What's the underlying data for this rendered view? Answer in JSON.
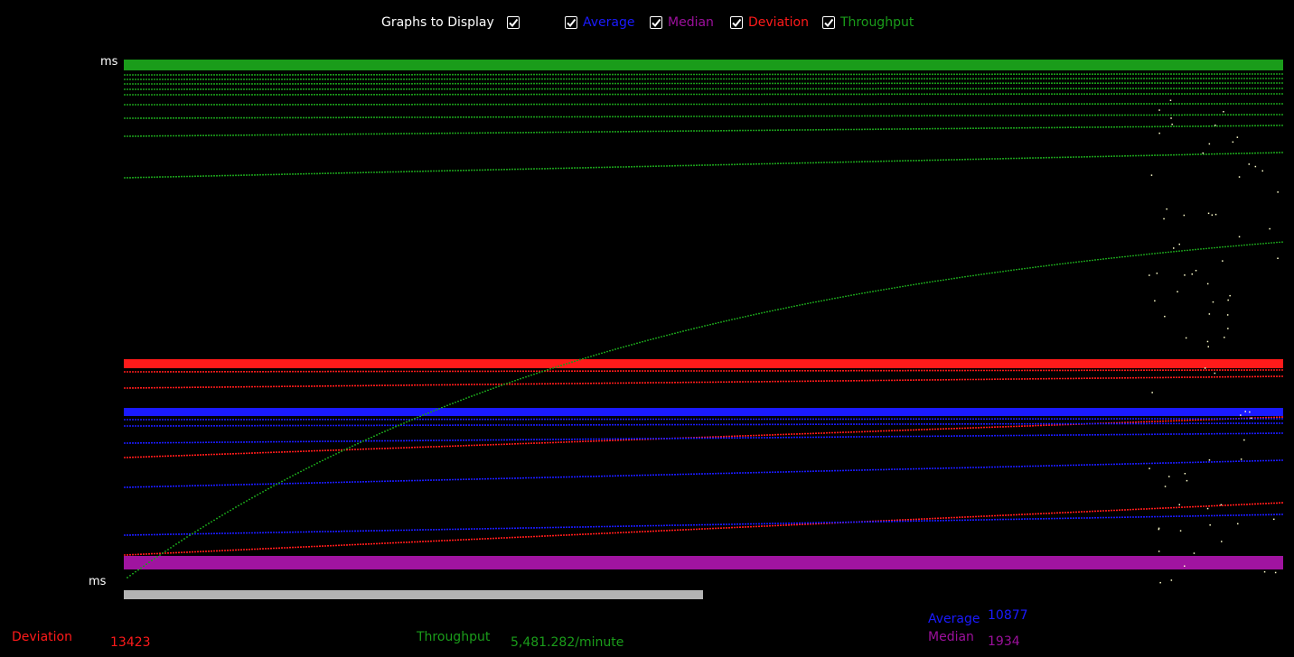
{
  "header": {
    "title": "Graphs to Display",
    "toggles": [
      {
        "label": "Average",
        "checked": true,
        "color": "#1a1aff"
      },
      {
        "label": "Median",
        "checked": true,
        "color": "#9c109c"
      },
      {
        "label": "Deviation",
        "checked": true,
        "color": "#ff1a1a"
      },
      {
        "label": "Throughput",
        "checked": true,
        "color": "#1a9c1a"
      }
    ]
  },
  "axis": {
    "top_unit": "ms",
    "bottom_unit": "ms"
  },
  "progress": {
    "fraction": 0.5
  },
  "stats": {
    "deviation_label": "Deviation",
    "deviation_value": "13423",
    "throughput_label": "Throughput",
    "throughput_value": "5,481.282/minute",
    "average_label": "Average",
    "average_value": "10877",
    "median_label": "Median",
    "median_value": "1934"
  },
  "colors": {
    "average": "#1a1aff",
    "median": "#a014a0",
    "deviation": "#ff1a1a",
    "throughput": "#1a9c1a",
    "samples": "#ffffcc"
  }
}
